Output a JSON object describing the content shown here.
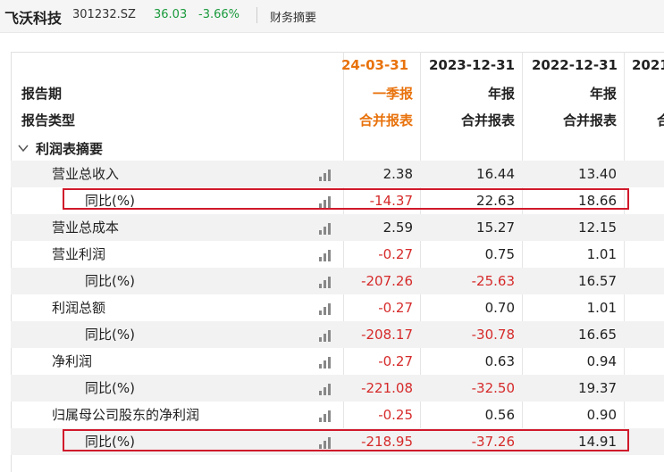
{
  "header": {
    "stock_name": "飞沃科技",
    "stock_code": "301232.SZ",
    "price": "36.03",
    "change": "-3.66%",
    "section_title": "财务摘要"
  },
  "table": {
    "row_labels": {
      "period": "报告期",
      "type": "报告类型"
    },
    "columns": [
      {
        "date": "24-03-31",
        "period": "一季报",
        "type": "合并报表"
      },
      {
        "date": "2023-12-31",
        "period": "年报",
        "type": "合并报表"
      },
      {
        "date": "2022-12-31",
        "period": "年报",
        "type": "合并报表"
      },
      {
        "date": "2021",
        "period": "",
        "type": "合"
      }
    ],
    "section": "利润表摘要",
    "rows": [
      {
        "label": "营业总收入",
        "values": [
          "2.38",
          "16.44",
          "13.40"
        ]
      },
      {
        "label": "同比(%)",
        "values": [
          "-14.37",
          "22.63",
          "18.66"
        ]
      },
      {
        "label": "营业总成本",
        "values": [
          "2.59",
          "15.27",
          "12.15"
        ]
      },
      {
        "label": "营业利润",
        "values": [
          "-0.27",
          "0.75",
          "1.01"
        ]
      },
      {
        "label": "同比(%)",
        "values": [
          "-207.26",
          "-25.63",
          "16.57"
        ]
      },
      {
        "label": "利润总额",
        "values": [
          "-0.27",
          "0.70",
          "1.01"
        ]
      },
      {
        "label": "同比(%)",
        "values": [
          "-208.17",
          "-30.78",
          "16.65"
        ]
      },
      {
        "label": "净利润",
        "values": [
          "-0.27",
          "0.63",
          "0.94"
        ]
      },
      {
        "label": "同比(%)",
        "values": [
          "-221.08",
          "-32.50",
          "19.37"
        ]
      },
      {
        "label": "归属母公司股东的净利润",
        "values": [
          "-0.25",
          "0.56",
          "0.90"
        ]
      },
      {
        "label": "同比(%)",
        "values": [
          "-218.95",
          "-37.26",
          "14.91"
        ]
      }
    ]
  },
  "colors": {
    "negative": "#d62a2a",
    "up_green": "#1a9a3c",
    "highlight": "#e8720c",
    "annotation_box": "#d0192b"
  }
}
